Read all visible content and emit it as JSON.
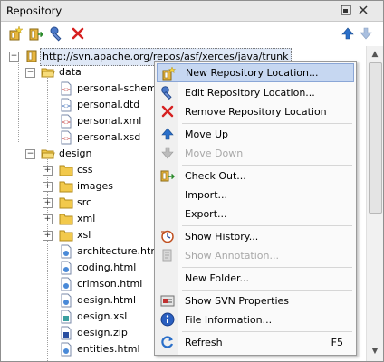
{
  "panel": {
    "title": "Repository"
  },
  "titlebar_buttons": [
    "maximize-icon",
    "close-icon"
  ],
  "toolbar": {
    "left": [
      "new-location-icon",
      "checkout-icon",
      "edit-location-icon",
      "remove-icon"
    ],
    "right": [
      "move-up-icon",
      "move-down-icon"
    ]
  },
  "tree": {
    "root": "http://svn.apache.org/repos/asf/xerces/java/trunk",
    "data_folder": "data",
    "data_files": [
      "personal-schema.x",
      "personal.dtd",
      "personal.xml",
      "personal.xsd"
    ],
    "design_folder": "design",
    "design_subfolders": [
      "css",
      "images",
      "src",
      "xml",
      "xsl"
    ],
    "design_files": [
      "architecture.html",
      "coding.html",
      "crimson.html",
      "design.html",
      "design.xsl",
      "design.zip",
      "entities.html"
    ]
  },
  "menu": {
    "items": [
      {
        "label": "New Repository Location...",
        "icon": "new-location-icon",
        "highlighted": true,
        "disabled": false
      },
      {
        "label": "Edit Repository Location...",
        "icon": "edit-location-icon",
        "disabled": false
      },
      {
        "label": "Remove Repository Location",
        "icon": "remove-icon",
        "disabled": false
      },
      {
        "label": "Move Up",
        "icon": "move-up-icon",
        "disabled": false
      },
      {
        "label": "Move Down",
        "icon": "move-down-icon",
        "disabled": true
      },
      {
        "label": "Check Out...",
        "icon": "checkout-icon",
        "disabled": false
      },
      {
        "label": "Import...",
        "icon": "",
        "disabled": false
      },
      {
        "label": "Export...",
        "icon": "",
        "disabled": false
      },
      {
        "label": "Show History...",
        "icon": "history-icon",
        "disabled": false
      },
      {
        "label": "Show Annotation...",
        "icon": "annotation-icon",
        "disabled": true
      },
      {
        "label": "New Folder...",
        "icon": "",
        "disabled": false
      },
      {
        "label": "Show SVN Properties",
        "icon": "properties-icon",
        "disabled": false
      },
      {
        "label": "File Information...",
        "icon": "info-icon",
        "disabled": false
      },
      {
        "label": "Refresh",
        "icon": "refresh-icon",
        "shortcut": "F5",
        "disabled": false
      }
    ]
  },
  "colors": {
    "folder": "#f2c94c",
    "remove": "#d62020",
    "arrow": "#2a6fc9",
    "highlight": "#c6d7f1"
  }
}
